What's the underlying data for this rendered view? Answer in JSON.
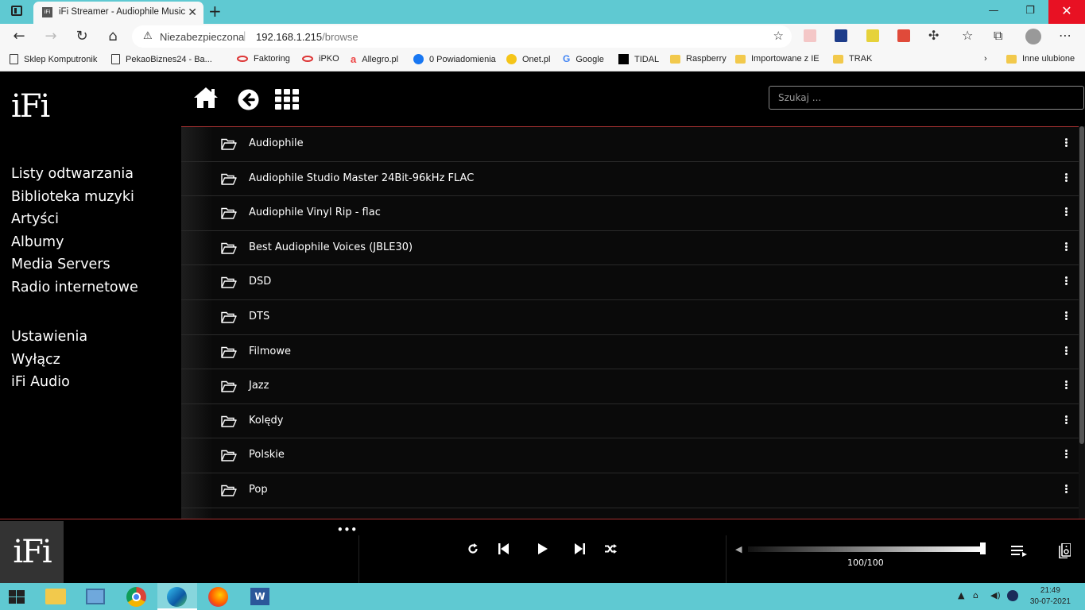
{
  "browser": {
    "tab_title": "iFi Streamer - Audiophile Music P",
    "tab_favicon": "iFi",
    "tab_close": "✕",
    "new_tab": "+",
    "address": {
      "security_label": "Niezabezpieczona",
      "host": "192.168.1.215",
      "path": "/browse"
    },
    "bookmarks": [
      {
        "label": "Sklep Komputronik",
        "icon": "page-icon"
      },
      {
        "label": "PekaoBiznes24 - Ba...",
        "icon": "pekao-icon"
      },
      {
        "label": "Faktoring",
        "icon": "pekao-icon"
      },
      {
        "label": "iPKO",
        "icon": "ipko-icon"
      },
      {
        "label": "Allegro.pl",
        "icon": "allegro-icon"
      },
      {
        "label": "0 Powiadomienia",
        "icon": "facebook-icon"
      },
      {
        "label": "Onet.pl",
        "icon": "onet-icon"
      },
      {
        "label": "Google",
        "icon": "google-icon"
      },
      {
        "label": "TIDAL",
        "icon": "tidal-icon"
      },
      {
        "label": "Raspberry",
        "icon": "folder-icon"
      },
      {
        "label": "Importowane z IE",
        "icon": "folder-icon"
      },
      {
        "label": "TRAK",
        "icon": "folder-icon"
      },
      {
        "label": "Inne ulubione",
        "icon": "folder-icon"
      }
    ]
  },
  "app": {
    "logo": "iFi",
    "search_placeholder": "Szukaj ...",
    "nav_main": [
      "Listy odtwarzania",
      "Biblioteka muzyki",
      "Artyści",
      "Albumy",
      "Media Servers",
      "Radio internetowe"
    ],
    "nav_secondary": [
      "Ustawienia",
      "Wyłącz",
      "iFi Audio"
    ],
    "folders": [
      "Audiophile",
      "Audiophile Studio Master 24Bit-96kHz FLAC",
      "Audiophile Vinyl Rip - flac",
      "Best Audiophile Voices (JBLE30)",
      "DSD",
      "DTS",
      "Filmowe",
      "Jazz",
      "Kolędy",
      "Polskie",
      "Pop"
    ],
    "player": {
      "more": "•••",
      "volume": 100,
      "volume_label": "100/100",
      "albumart_text": "iFi"
    }
  },
  "taskbar": {
    "time": "21:49",
    "date": "30-07-2021"
  },
  "colors": {
    "browser_accent": "#5fc9d2",
    "app_bg": "#000000",
    "divider_red": "#aa3333",
    "close_red": "#e81123"
  }
}
